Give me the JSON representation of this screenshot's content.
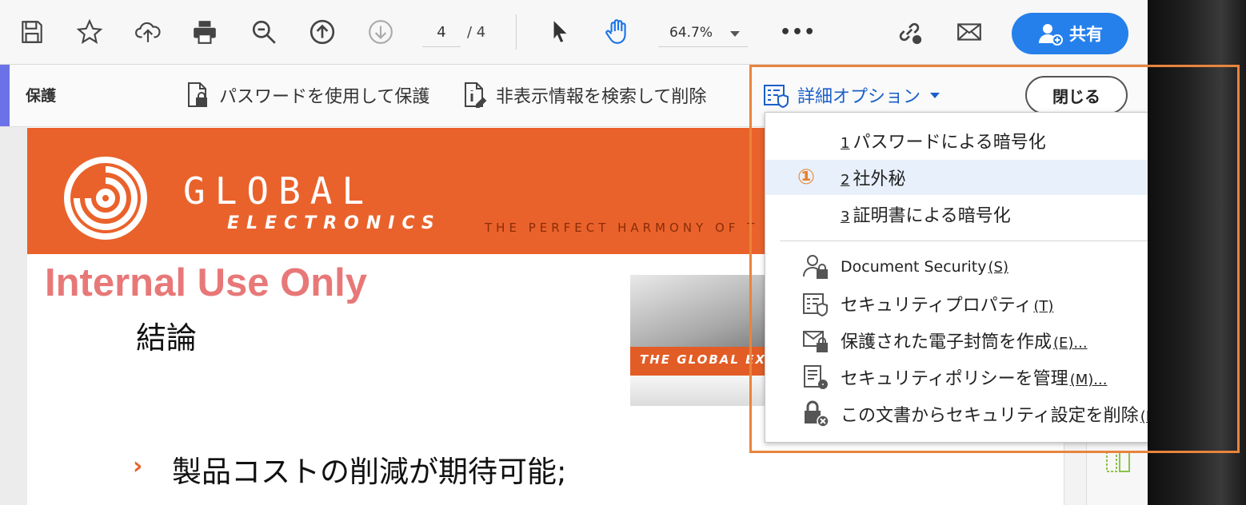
{
  "toolbar": {
    "icons": [
      "save-icon",
      "bookmark-star-icon",
      "cloud-upload-icon",
      "print-icon",
      "zoom-out-icon",
      "page-up-icon",
      "page-down-icon",
      "select-cursor-icon",
      "hand-tool-icon",
      "link-icon",
      "email-icon"
    ],
    "page_current": "4",
    "page_total": "/ 4",
    "zoom_value": "64.7%",
    "more_label": "•••",
    "share_label": "共有"
  },
  "protect_bar": {
    "title": "保護",
    "password_protect_label": "パスワードを使用して保護",
    "redact_label": "非表示情報を検索して削除",
    "more_options_label": "詳細オプション",
    "close_label": "閉じる"
  },
  "menu": {
    "items": [
      {
        "accel": "1",
        "label": "パスワードによる暗号化"
      },
      {
        "accel": "2",
        "label": "社外秘",
        "marker": "①"
      },
      {
        "accel": "3",
        "label": "証明書による暗号化"
      }
    ],
    "items2": [
      {
        "label": "Document Security",
        "accel": "(S)",
        "icon": "user-lock-icon"
      },
      {
        "label": "セキュリティプロパティ",
        "accel": "(T)",
        "icon": "security-properties-icon"
      },
      {
        "label": "保護された電子封筒を作成",
        "accel": "(E)...",
        "icon": "secure-envelope-icon"
      },
      {
        "label": "セキュリティポリシーを管理",
        "accel": "(M)...",
        "icon": "policy-manage-icon"
      },
      {
        "label": "この文書からセキュリティ設定を削除",
        "accel": "(R)",
        "icon": "remove-security-icon"
      }
    ]
  },
  "document": {
    "brand_top": "GLOBAL",
    "brand_bottom": "ELECTRONICS",
    "tagline": "THE PERFECT HARMONY OF T",
    "internal_label": "Internal Use Only",
    "heading": "結論",
    "bullet_arrow": "›",
    "bullet_text": "製品コストの削減が期待可能;",
    "photo_caption": "THE GLOBAL EX"
  },
  "colors": {
    "accent_blue": "#2680eb",
    "banner_orange": "#ea622b",
    "highlight_orange": "#e9843c",
    "internal_pink": "#e87878"
  }
}
